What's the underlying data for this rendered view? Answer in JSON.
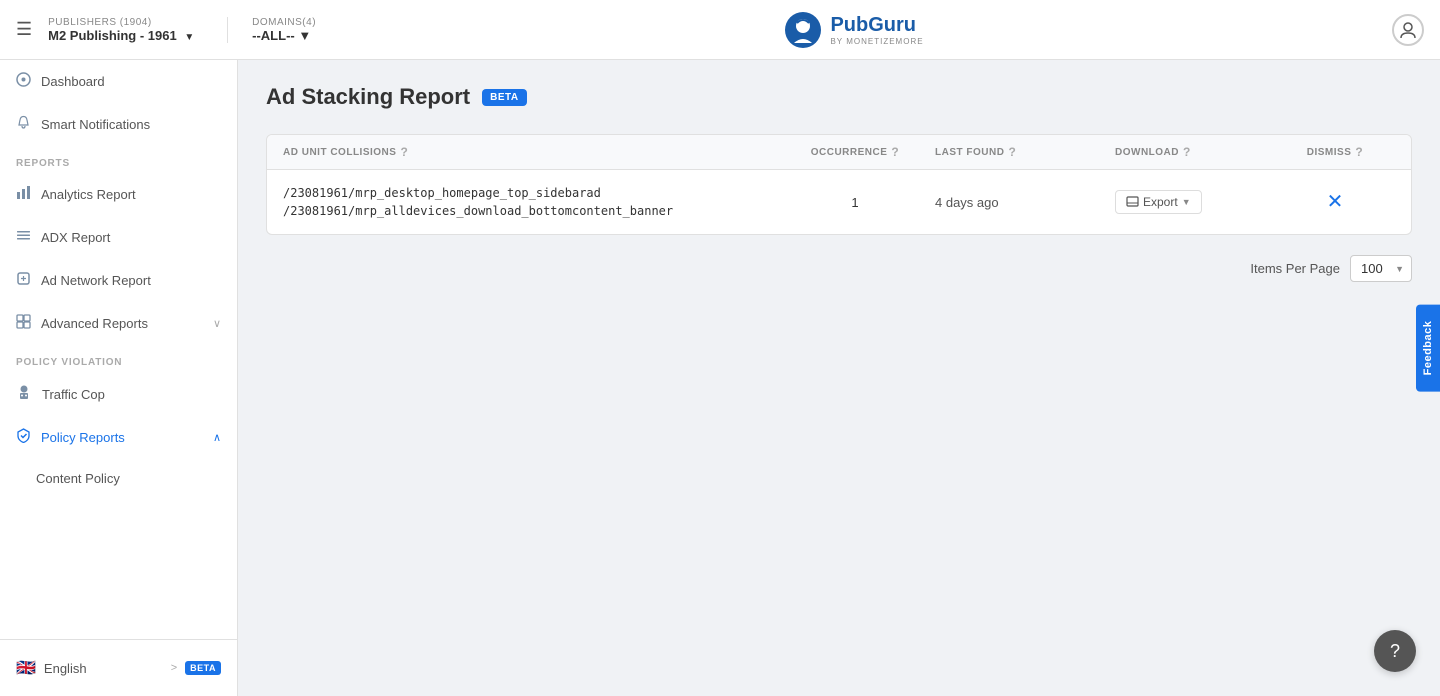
{
  "header": {
    "menu_icon": "☰",
    "publishers_label": "PUBLISHERS (1904)",
    "publisher_value": "M2 Publishing - 1961",
    "domains_label": "DOMAINS(4)",
    "domains_value": "--ALL--",
    "logo_main": "PubGuru",
    "logo_sub": "by MONETIZEMORE"
  },
  "sidebar": {
    "nav_items": [
      {
        "id": "dashboard",
        "label": "Dashboard",
        "icon": "○"
      },
      {
        "id": "smart-notifications",
        "label": "Smart Notifications",
        "icon": "🔔"
      }
    ],
    "reports_label": "REPORTS",
    "reports_items": [
      {
        "id": "analytics",
        "label": "Analytics Report",
        "icon": "📊"
      },
      {
        "id": "adx",
        "label": "ADX Report",
        "icon": "≡"
      },
      {
        "id": "ad-network",
        "label": "Ad Network Report",
        "icon": "◇"
      },
      {
        "id": "advanced-reports",
        "label": "Advanced Reports",
        "icon": "◫",
        "has_chevron": true,
        "chevron": "∨"
      }
    ],
    "policy_label": "POLICY VIOLATION",
    "policy_items": [
      {
        "id": "traffic-cop",
        "label": "Traffic Cop",
        "icon": "👮"
      },
      {
        "id": "policy-reports",
        "label": "Policy Reports",
        "icon": "🛡",
        "has_chevron": true,
        "chevron": "∧",
        "active": true
      }
    ],
    "sub_items": [
      {
        "id": "content-policy",
        "label": "Content Policy"
      }
    ],
    "language": {
      "flag": "🇬🇧",
      "label": "English",
      "arrow": ">",
      "badge": "BETA"
    }
  },
  "main": {
    "page_title": "Ad Stacking Report",
    "beta_label": "BETA",
    "table": {
      "columns": [
        {
          "id": "ad-unit-collisions",
          "label": "AD UNIT COLLISIONS"
        },
        {
          "id": "occurrence",
          "label": "OCCURRENCE"
        },
        {
          "id": "last-found",
          "label": "LAST FOUND"
        },
        {
          "id": "download",
          "label": "DOWNLOAD"
        },
        {
          "id": "dismiss",
          "label": "DISMISS"
        }
      ],
      "rows": [
        {
          "path1": "/23081961/mrp_desktop_homepage_top_sidebarad",
          "path2": "/23081961/mrp_alldevices_download_bottomcontent_banner",
          "occurrence": "1",
          "last_found": "4 days ago",
          "export_label": "Export"
        }
      ]
    },
    "pagination": {
      "label": "Items Per Page",
      "value": "100"
    }
  },
  "feedback": {
    "label": "Feedback"
  },
  "help": {
    "icon": "?"
  }
}
